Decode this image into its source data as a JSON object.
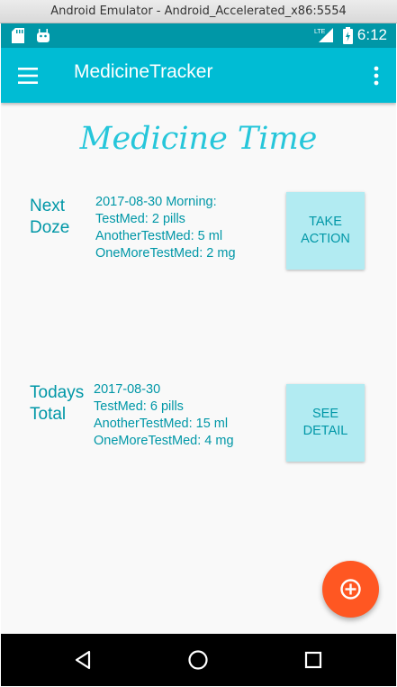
{
  "window": {
    "title": "Android Emulator - Android_Accelerated_x86:5554"
  },
  "status_bar": {
    "time": "6:12",
    "icons": [
      "sd-card-icon",
      "android-icon",
      "lte-signal-icon",
      "battery-icon"
    ]
  },
  "app_bar": {
    "title": "MedicineTracker",
    "icons": [
      "menu-icon",
      "more-vert-icon"
    ]
  },
  "main": {
    "heading": "Medicine Time",
    "next_doze": {
      "label_line1": "Next",
      "label_line2": "Doze",
      "lines": [
        "2017-08-30 Morning:",
        "TestMed: 2 pills",
        "AnotherTestMed: 5 ml",
        "OneMoreTestMed: 2 mg"
      ],
      "button_line1": "TAKE",
      "button_line2": "ACTION"
    },
    "todays_total": {
      "label_line1": "Todays",
      "label_line2": "Total",
      "lines": [
        "2017-08-30",
        "TestMed: 6 pills",
        "AnotherTestMed: 15 ml",
        "OneMoreTestMed: 4 mg"
      ],
      "button_line1": "SEE",
      "button_line2": "DETAIL"
    }
  },
  "fab": {
    "icon": "add-circle-icon"
  },
  "nav_bar": {
    "icons": [
      "back-icon",
      "home-icon",
      "recents-icon"
    ]
  },
  "colors": {
    "status_bar": "#0097a7",
    "app_bar": "#00bcd4",
    "text_teal": "#0097a7",
    "heading": "#26c6da",
    "button_bg": "#b2ebf2",
    "fab": "#ff5722"
  }
}
